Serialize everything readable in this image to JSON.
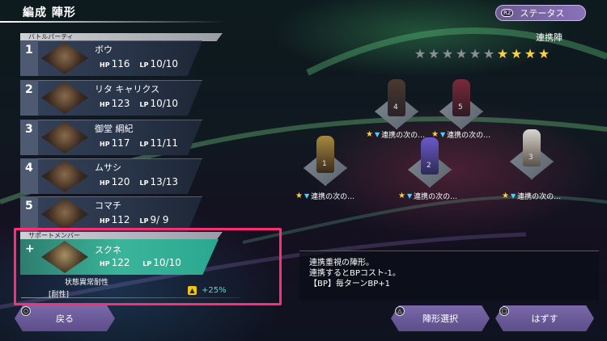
{
  "header": {
    "title": "編成 陣形",
    "status_button": "ステータス",
    "status_button_badge": "R2"
  },
  "battle_party": {
    "label": "バトルパーティ",
    "members": [
      {
        "num": "1",
        "name": "ボウ",
        "hp": "116",
        "lp": "10/10"
      },
      {
        "num": "2",
        "name": "リタ キャリクス",
        "hp": "123",
        "lp": "10/10"
      },
      {
        "num": "3",
        "name": "御堂 綱紀",
        "hp": "117",
        "lp": "11/11"
      },
      {
        "num": "4",
        "name": "ムサシ",
        "hp": "120",
        "lp": "13/13"
      },
      {
        "num": "5",
        "name": "コマチ",
        "hp": "112",
        "lp": "9/ 9"
      }
    ],
    "hp_tag": "HP",
    "lp_tag": "LP"
  },
  "support": {
    "label": "サポートメンバー",
    "plus": "+",
    "name": "スクネ",
    "hp": "122",
    "lp": "10/10",
    "skill_name": "状態異常耐性",
    "skill_tag": "[耐性]",
    "skill_bonus": "+25%"
  },
  "formation": {
    "label": "連携陣",
    "stars_total": 10,
    "stars_filled": 4,
    "slots": [
      {
        "num": "4",
        "text": "連携の次の…",
        "style": "dark"
      },
      {
        "num": "5",
        "text": "連携の次の…",
        "style": "red"
      },
      {
        "num": "1",
        "text": "連携の次の…",
        "style": "gold"
      },
      {
        "num": "2",
        "text": "連携の次の…",
        "style": "blue"
      },
      {
        "num": "3",
        "text": "連携の次の…",
        "style": "light"
      }
    ]
  },
  "description": {
    "line1": "連携重視の陣形。",
    "line2": "連携するとBPコスト-1。",
    "line3": "【BP】毎ターンBP+1"
  },
  "buttons": {
    "back": "戻る",
    "formation_select": "陣形選択",
    "remove": "はずす"
  },
  "colors": {
    "highlight_border": "#ff2e74",
    "support_card": "#3bb59a",
    "star_on": "#ffd23a"
  }
}
